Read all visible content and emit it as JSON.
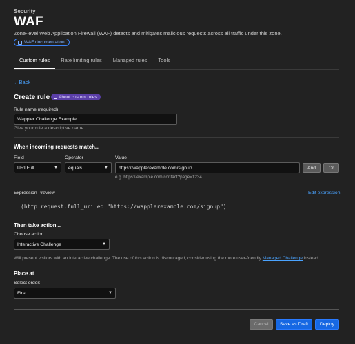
{
  "header": {
    "section": "Security",
    "title": "WAF",
    "description": "Zone-level Web Application Firewall (WAF) detects and mitigates malicious requests across all traffic under this zone.",
    "doc_link": "WAF documentation"
  },
  "tabs": [
    {
      "label": "Custom rules",
      "active": true
    },
    {
      "label": "Rate limiting rules",
      "active": false
    },
    {
      "label": "Managed rules",
      "active": false
    },
    {
      "label": "Tools",
      "active": false
    }
  ],
  "back_label": "Back",
  "create": {
    "title": "Create rule",
    "badge": "About custom rules",
    "rule_name_label": "Rule name (required)",
    "rule_name_value": "Wappler Challenge Example",
    "rule_name_hint": "Give your rule a descriptive name."
  },
  "match": {
    "title": "When incoming requests match...",
    "field_label": "Field",
    "operator_label": "Operator",
    "value_label": "Value",
    "field_value": "URI Full",
    "operator_value": "equals",
    "value_value": "https://wapplerexample.com/signup",
    "value_hint": "e.g. https://example.com/contact?page=1234",
    "and_label": "And",
    "or_label": "Or"
  },
  "expression": {
    "label": "Expression Preview",
    "edit_label": "Edit expression",
    "text": "(http.request.full_uri eq \"https://wapplerexample.com/signup\")"
  },
  "action": {
    "title": "Then take action...",
    "choose_label": "Choose action",
    "selected": "Interactive Challenge",
    "hint_before": "Will present visitors with an interactive challenge. The use of this action is discouraged, consider using the more user-friendly ",
    "hint_link": "Managed Challenge",
    "hint_after": " instead."
  },
  "place": {
    "title": "Place at",
    "order_label": "Select order:",
    "order_value": "First"
  },
  "footer": {
    "cancel": "Cancel",
    "save_draft": "Save as Draft",
    "deploy": "Deploy"
  },
  "colors": {
    "background": "#222222",
    "primary": "#1668e3",
    "badge": "#5b3fa8",
    "link": "#4aa3ff"
  }
}
